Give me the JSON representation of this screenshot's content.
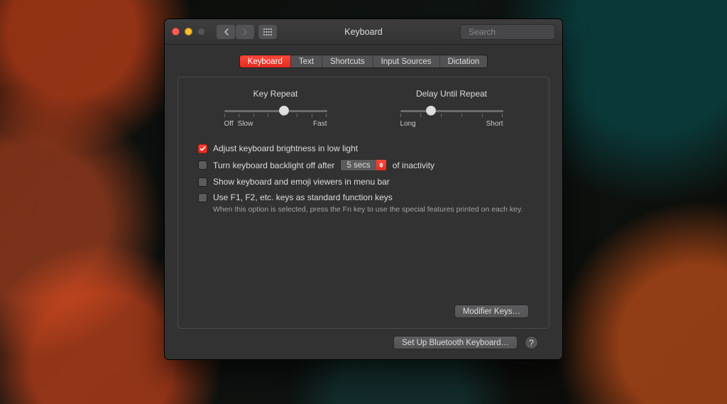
{
  "window": {
    "title": "Keyboard"
  },
  "search": {
    "placeholder": "Search",
    "value": ""
  },
  "tabs": {
    "items": [
      "Keyboard",
      "Text",
      "Shortcuts",
      "Input Sources",
      "Dictation"
    ],
    "active_index": 0
  },
  "sliders": {
    "key_repeat": {
      "label": "Key Repeat",
      "left_label_off": "Off",
      "left_label_slow": "Slow",
      "right_label": "Fast",
      "value_percent": 58,
      "ticks": 8
    },
    "delay_until_repeat": {
      "label": "Delay Until Repeat",
      "left_label": "Long",
      "right_label": "Short",
      "value_percent": 30,
      "ticks": 6
    }
  },
  "options": {
    "auto_brightness": {
      "label": "Adjust keyboard brightness in low light",
      "checked": true
    },
    "backlight_off": {
      "label_pre": "Turn keyboard backlight off after",
      "label_post": "of inactivity",
      "value": "5 secs",
      "checked": false
    },
    "show_viewers": {
      "label": "Show keyboard and emoji viewers in menu bar",
      "checked": false
    },
    "fn_keys": {
      "label": "Use F1, F2, etc. keys as standard function keys",
      "hint": "When this option is selected, press the Fn key to use the special features printed on each key.",
      "checked": false
    }
  },
  "buttons": {
    "modifier_keys": "Modifier Keys…",
    "bluetooth": "Set Up Bluetooth Keyboard…"
  },
  "icons": {
    "back": "chevron-left-icon",
    "forward": "chevron-right-icon",
    "grid": "grid-icon",
    "search": "search-icon",
    "help": "?"
  },
  "colors": {
    "accent": "#ff3b30"
  }
}
